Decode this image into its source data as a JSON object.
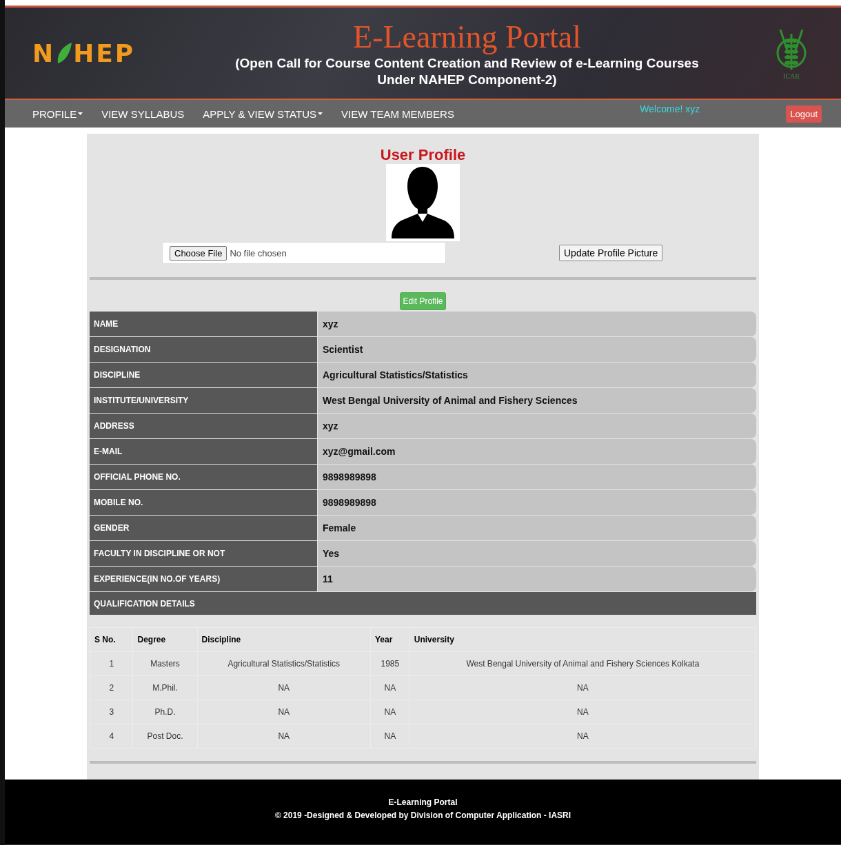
{
  "header": {
    "logo": {
      "before": "N",
      "after": "HEP"
    },
    "title": "E-Learning Portal",
    "subtitle_lines": [
      "(Open Call for Course Content Creation and Review of e-Learning Courses",
      "Under NAHEP Component-2)"
    ],
    "emblem_text": "ICAR"
  },
  "nav": {
    "items": [
      {
        "label": "PROFILE",
        "dropdown": true
      },
      {
        "label": "VIEW SYLLABUS",
        "dropdown": false
      },
      {
        "label": "APPLY & VIEW STATUS",
        "dropdown": true
      },
      {
        "label": "VIEW TEAM MEMBERS",
        "dropdown": false
      }
    ],
    "welcome": "Welcome! xyz",
    "logout": "Logout"
  },
  "profile": {
    "title": "User Profile",
    "choose_file": "Choose File",
    "file_status": "No file chosen",
    "update_button": "Update Profile Picture",
    "edit_button": "Edit Profile",
    "fields": [
      {
        "label": "NAME",
        "value": "xyz"
      },
      {
        "label": "DESIGNATION",
        "value": "Scientist"
      },
      {
        "label": "DISCIPLINE",
        "value": "Agricultural Statistics/Statistics"
      },
      {
        "label": "INSTITUTE/UNIVERSITY",
        "value": "West Bengal University of Animal and Fishery Sciences"
      },
      {
        "label": "ADDRESS",
        "value": "xyz"
      },
      {
        "label": "E-MAIL",
        "value": "xyz@gmail.com"
      },
      {
        "label": "OFFICIAL PHONE NO.",
        "value": "9898989898"
      },
      {
        "label": "MOBILE NO.",
        "value": "9898989898"
      },
      {
        "label": "GENDER",
        "value": "Female"
      },
      {
        "label": "FACULTY IN DISCIPLINE OR NOT",
        "value": "Yes"
      },
      {
        "label": "EXPERIENCE(IN NO.OF YEARS)",
        "value": "11"
      }
    ],
    "qualification_title": "QUALIFICATION DETAILS",
    "qualification_table": {
      "columns": [
        "S No.",
        "Degree",
        "Discipline",
        "Year",
        "University"
      ],
      "rows": [
        [
          "1",
          "Masters",
          "Agricultural Statistics/Statistics",
          "1985",
          "West Bengal University of Animal and Fishery Sciences Kolkata"
        ],
        [
          "2",
          "M.Phil.",
          "NA",
          "NA",
          "NA"
        ],
        [
          "3",
          "Ph.D.",
          "NA",
          "NA",
          "NA"
        ],
        [
          "4",
          "Post Doc.",
          "NA",
          "NA",
          "NA"
        ]
      ]
    }
  },
  "footer": {
    "title": "E-Learning Portal",
    "credit": "© 2019 -Designed & Developed by Division of Computer Application - IASRI"
  }
}
